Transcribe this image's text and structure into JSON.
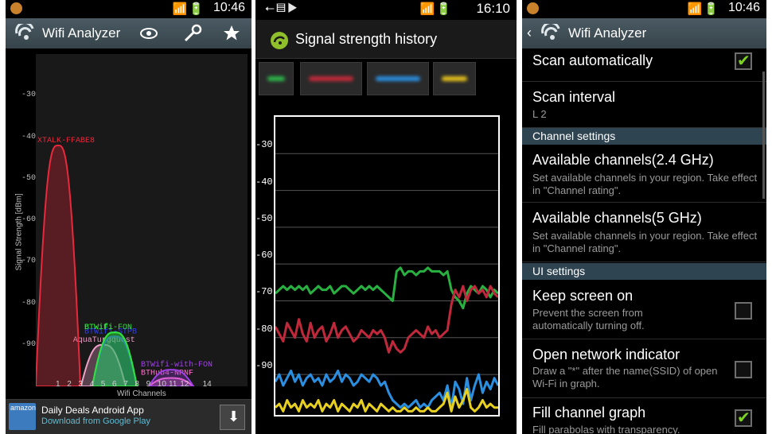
{
  "panel1": {
    "status_time": "10:46",
    "title": "Wifi Analyzer",
    "y_axis_title": "Signal Strength [dBm]",
    "x_axis_title": "Wifi Channels",
    "ad": {
      "title": "Daily Deals Android App",
      "subtitle": "Download from Google Play",
      "logo_text": "amazon"
    }
  },
  "panel2": {
    "status_time": "16:10",
    "title": "Signal strength history"
  },
  "panel3": {
    "status_time": "10:46",
    "title": "Wifi Analyzer",
    "rows": [
      {
        "title": "Scan automatically",
        "subtitle": "",
        "checked": true
      },
      {
        "title": "Scan interval",
        "subtitle": "L 2"
      },
      {
        "title": "Available channels(2.4 GHz)",
        "subtitle": "Set available channels in your region. Take effect in \"Channel rating\"."
      },
      {
        "title": "Available channels(5 GHz)",
        "subtitle": "Set available channels in your region. Take effect in \"Channel rating\"."
      },
      {
        "title": "Keep screen on",
        "subtitle": "Prevent the screen from automatically turning off.",
        "checked": false
      },
      {
        "title": "Open network indicator",
        "subtitle": "Draw a \"*\" after the name(SSID) of open Wi-Fi in graph.",
        "checked": false
      },
      {
        "title": "Fill channel graph",
        "subtitle": "Fill parabolas with transparency.",
        "checked": true
      }
    ],
    "sections": [
      "Channel settings",
      "UI settings"
    ]
  },
  "chart_data": [
    {
      "type": "area",
      "xlabel": "Wifi Channels",
      "ylabel": "Signal Strength [dBm]",
      "x_ticks": [
        "1",
        "2",
        "3",
        "4",
        "5",
        "6",
        "7",
        "8",
        "9",
        "10",
        "11",
        "12",
        "14"
      ],
      "y_ticks": [
        "-30",
        "-40",
        "-50",
        "-60",
        "-70",
        "-80",
        "-90"
      ],
      "ylim": [
        -100,
        -20
      ],
      "series": [
        {
          "name": "XTALK-FFABE8",
          "channel": 1,
          "peak_dbm": -42,
          "color": "#e8283c"
        },
        {
          "name": "BTWifi-FON",
          "channel": 6,
          "peak_dbm": -87,
          "color": "#30e040"
        },
        {
          "name": "BTWiFi",
          "channel": 6,
          "peak_dbm": -87,
          "color": "#30e040"
        },
        {
          "name": "AquaTurgquest",
          "channel": 5,
          "peak_dbm": -90,
          "color": "#f0a0c8"
        },
        {
          "name": "BTWifi-with-FON",
          "channel": 11,
          "peak_dbm": -96,
          "color": "#a040e8"
        },
        {
          "name": "BTHub4-NPNF",
          "channel": 11,
          "peak_dbm": -98,
          "color": "#ff70d0"
        },
        {
          "name": "BTWifi-STPB",
          "channel": 6,
          "peak_dbm": -88,
          "color": "#2b3cff"
        }
      ]
    },
    {
      "type": "line",
      "y_ticks": [
        "-30",
        "-40",
        "-50",
        "-60",
        "-70",
        "-80",
        "-90"
      ],
      "ylim": [
        -101,
        -20
      ],
      "series": [
        {
          "color": "#28b040",
          "values": [
            -68,
            -67,
            -66,
            -67,
            -66,
            -67,
            -66,
            -67,
            -66,
            -68,
            -67,
            -66,
            -67,
            -67,
            -66,
            -68,
            -67,
            -66,
            -66,
            -67,
            -68,
            -67,
            -66,
            -67,
            -66,
            -67,
            -66,
            -67,
            -68,
            -69,
            -70,
            -62,
            -61,
            -63,
            -62,
            -62,
            -63,
            -62,
            -62,
            -61,
            -62,
            -62,
            -62,
            -63,
            -62,
            -67,
            -69,
            -70,
            -72,
            -68,
            -66,
            -67,
            -68,
            -66,
            -67,
            -69,
            -67,
            -68
          ]
        },
        {
          "color": "#c0283c",
          "values": [
            -77,
            -79,
            -81,
            -76,
            -78,
            -80,
            -75,
            -79,
            -81,
            -76,
            -80,
            -78,
            -77,
            -81,
            -79,
            -76,
            -80,
            -78,
            -77,
            -79,
            -81,
            -80,
            -78,
            -79,
            -80,
            -78,
            -79,
            -78,
            -80,
            -84,
            -81,
            -83,
            -84,
            -83,
            -80,
            -79,
            -78,
            -79,
            -80,
            -77,
            -79,
            -78,
            -80,
            -79,
            -78,
            -71,
            -67,
            -69,
            -66,
            -70,
            -67,
            -66,
            -68,
            -67,
            -69,
            -66,
            -68,
            -69
          ]
        },
        {
          "color": "#2a8fe0",
          "values": [
            -92,
            -90,
            -93,
            -91,
            -89,
            -92,
            -90,
            -93,
            -91,
            -90,
            -92,
            -91,
            -93,
            -90,
            -92,
            -91,
            -89,
            -92,
            -90,
            -91,
            -93,
            -92,
            -90,
            -91,
            -92,
            -90,
            -91,
            -93,
            -92,
            -95,
            -97,
            -98,
            -99,
            -98,
            -99,
            -98,
            -97,
            -99,
            -98,
            -99,
            -97,
            -96,
            -95,
            -97,
            -93,
            -99,
            -92,
            -94,
            -98,
            -91,
            -97,
            -93,
            -90,
            -95,
            -92,
            -94,
            -91,
            -93
          ]
        },
        {
          "color": "#e8d020",
          "values": [
            -99,
            -98,
            -100,
            -97,
            -99,
            -98,
            -100,
            -97,
            -99,
            -98,
            -99,
            -97,
            -100,
            -98,
            -99,
            -97,
            -100,
            -98,
            -99,
            -100,
            -98,
            -99,
            -97,
            -100,
            -98,
            -99,
            -100,
            -98,
            -99,
            -100,
            -99,
            -100,
            -100,
            -99,
            -100,
            -100,
            -99,
            -100,
            -100,
            -99,
            -100,
            -100,
            -99,
            -98,
            -95,
            -100,
            -96,
            -99,
            -97,
            -94,
            -99,
            -100,
            -99,
            -97,
            -99,
            -98,
            -99,
            -99
          ]
        }
      ]
    }
  ]
}
